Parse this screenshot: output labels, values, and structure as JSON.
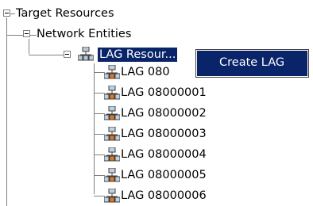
{
  "tree": {
    "root_label": "Target Resources",
    "network_label": "Network Entities",
    "lag_resources_label": "LAG Resour...",
    "children": [
      "LAG 080",
      "LAG 08000001",
      "LAG 08000002",
      "LAG 08000003",
      "LAG 08000004",
      "LAG 08000005",
      "LAG 08000006"
    ]
  },
  "context_menu": {
    "items": [
      "Create LAG"
    ]
  },
  "colors": {
    "selection_bg": "#0a246a",
    "tree_lines": "#808080"
  },
  "icons": {
    "expander": "minus-expander-icon",
    "lag_group": "network-group-icon",
    "lag_item": "network-node-icon"
  }
}
